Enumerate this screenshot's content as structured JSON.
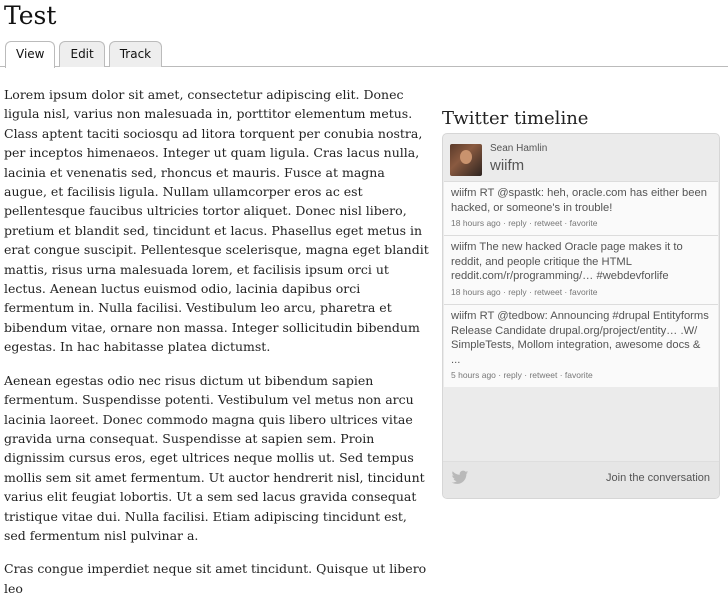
{
  "page": {
    "title": "Test"
  },
  "tabs": [
    {
      "label": "View",
      "active": true
    },
    {
      "label": "Edit",
      "active": false
    },
    {
      "label": "Track",
      "active": false
    }
  ],
  "body": {
    "paragraphs": [
      "Lorem ipsum dolor sit amet, consectetur adipiscing elit. Donec ligula nisl, varius non malesuada in, porttitor elementum metus. Class aptent taciti sociosqu ad litora torquent per conubia nostra, per inceptos himenaeos. Integer ut quam ligula. Cras lacus nulla, lacinia et venenatis sed, rhoncus et mauris. Fusce at magna augue, et facilisis ligula. Nullam ullamcorper eros ac est pellentesque faucibus ultricies tortor aliquet. Donec nisl libero, pretium et blandit sed, tincidunt et lacus. Phasellus eget metus in erat congue suscipit. Pellentesque scelerisque, magna eget blandit mattis, risus urna malesuada lorem, et facilisis ipsum orci ut lectus. Aenean luctus euismod odio, lacinia dapibus orci fermentum in. Nulla facilisi. Vestibulum leo arcu, pharetra et bibendum vitae, ornare non massa. Integer sollicitudin bibendum egestas. In hac habitasse platea dictumst.",
      "Aenean egestas odio nec risus dictum ut bibendum sapien fermentum. Suspendisse potenti. Vestibulum vel metus non arcu lacinia laoreet. Donec commodo magna quis libero ultrices vitae gravida urna consequat. Suspendisse at sapien sem. Proin dignissim cursus eros, eget ultrices neque mollis ut. Sed tempus mollis sem sit amet fermentum. Ut auctor hendrerit nisl, tincidunt varius elit feugiat lobortis. Ut a sem sed lacus gravida consequat tristique vitae dui. Nulla facilisi. Etiam adipiscing tincidunt est, sed fermentum nisl pulvinar a.",
      "Cras congue imperdiet neque sit amet tincidunt. Quisque ut libero leo"
    ]
  },
  "twitter": {
    "heading": "Twitter timeline",
    "user_name": "Sean Hamlin",
    "handle": "wiifm",
    "tweets": [
      {
        "text": "wiifm RT @spastk: heh, oracle.com has either been hacked, or someone's in trouble!",
        "time": "18 hours ago",
        "reply": "reply",
        "retweet": "retweet",
        "favorite": "favorite"
      },
      {
        "text": "wiifm The new hacked Oracle page makes it to reddit, and people critique the HTML reddit.com/r/programming/… #webdevforlife",
        "time": "18 hours ago",
        "reply": "reply",
        "retweet": "retweet",
        "favorite": "favorite"
      },
      {
        "text": "wiifm RT @tedbow: Announcing #drupal Entityforms Release Candidate drupal.org/project/entity… .W/ SimpleTests, Mollom integration, awesome docs & ...",
        "time": "5 hours ago",
        "reply": "reply",
        "retweet": "retweet",
        "favorite": "favorite"
      }
    ],
    "separator": " · ",
    "footer_link": "Join the conversation",
    "bird_icon": "twitter-bird-icon",
    "colors": {
      "box_bg": "#ebebeb",
      "tweet_bg": "#fafafa",
      "bird": "#b9b9b9"
    }
  }
}
